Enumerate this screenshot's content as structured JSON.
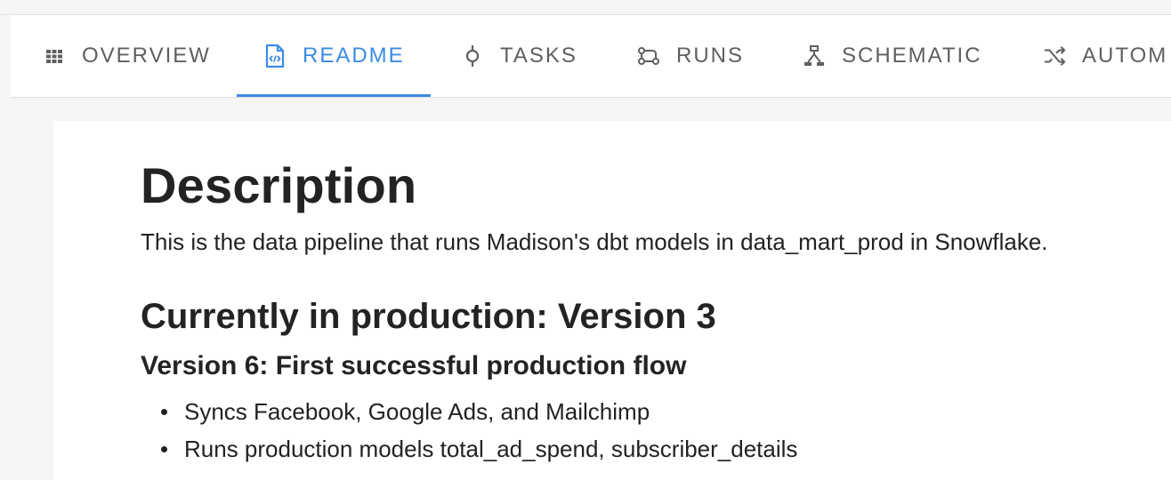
{
  "tabs": [
    {
      "label": "OVERVIEW",
      "icon": "grid-icon",
      "active": false
    },
    {
      "label": "README",
      "icon": "file-code-icon",
      "active": true
    },
    {
      "label": "TASKS",
      "icon": "commit-node-icon",
      "active": false
    },
    {
      "label": "RUNS",
      "icon": "runs-graph-icon",
      "active": false
    },
    {
      "label": "SCHEMATIC",
      "icon": "schematic-icon",
      "active": false
    },
    {
      "label": "AUTOM",
      "icon": "shuffle-icon",
      "active": false
    }
  ],
  "colors": {
    "accent": "#3b8be3",
    "tab_inactive": "#5f5f5f",
    "text": "#222222",
    "page_bg": "#f5f5f5",
    "panel_bg": "#ffffff"
  },
  "readme": {
    "title": "Description",
    "description": "This is the data pipeline that runs Madison's dbt models in data_mart_prod in Snowflake.",
    "production_heading": "Currently in production: Version 3",
    "version_heading": "Version 6: First successful production flow",
    "bullets": [
      "Syncs Facebook, Google Ads, and Mailchimp",
      "Runs production models total_ad_spend, subscriber_details"
    ]
  }
}
